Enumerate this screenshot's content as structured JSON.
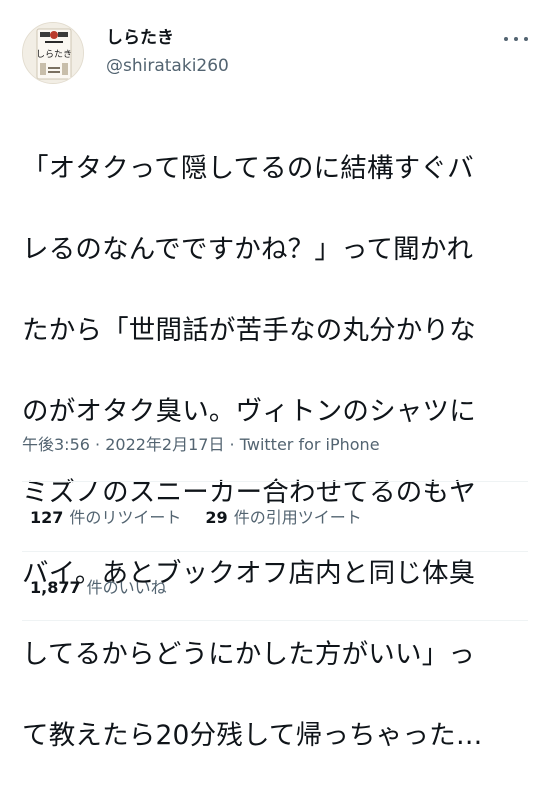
{
  "user": {
    "display_name": "しらたき",
    "handle": "@shirataki260",
    "avatar_icon": "shirataki-package-avatar",
    "avatar_label": "しらたき"
  },
  "more_icon": "more-dots-icon",
  "tweet": {
    "text_lines": [
      "「オタクって隠してるのに結構すぐバ",
      "レるのなんでですかね？」って聞かれ",
      "たから「世間話が苦手なの丸分かりな",
      "のがオタク臭い。ヴィトンのシャツに",
      "ミズノのスニーカー合わせてるのもヤ",
      "バイ。あとブックオフ店内と同じ体臭",
      "してるからどうにかした方がいい」っ",
      "て教えたら20分残して帰っちゃった…"
    ]
  },
  "meta": {
    "time": "午後3:56",
    "separator": " · ",
    "date": "2022年2月17日",
    "source": "Twitter for iPhone"
  },
  "stats": {
    "retweets": {
      "count": "127",
      "label": "件のリツイート"
    },
    "quotes": {
      "count": "29",
      "label": "件の引用ツイート"
    },
    "likes": {
      "count": "1,877",
      "label": "件のいいね"
    }
  },
  "colors": {
    "text": "#0f1419",
    "secondary": "#536471",
    "divider": "#eff3f4"
  }
}
